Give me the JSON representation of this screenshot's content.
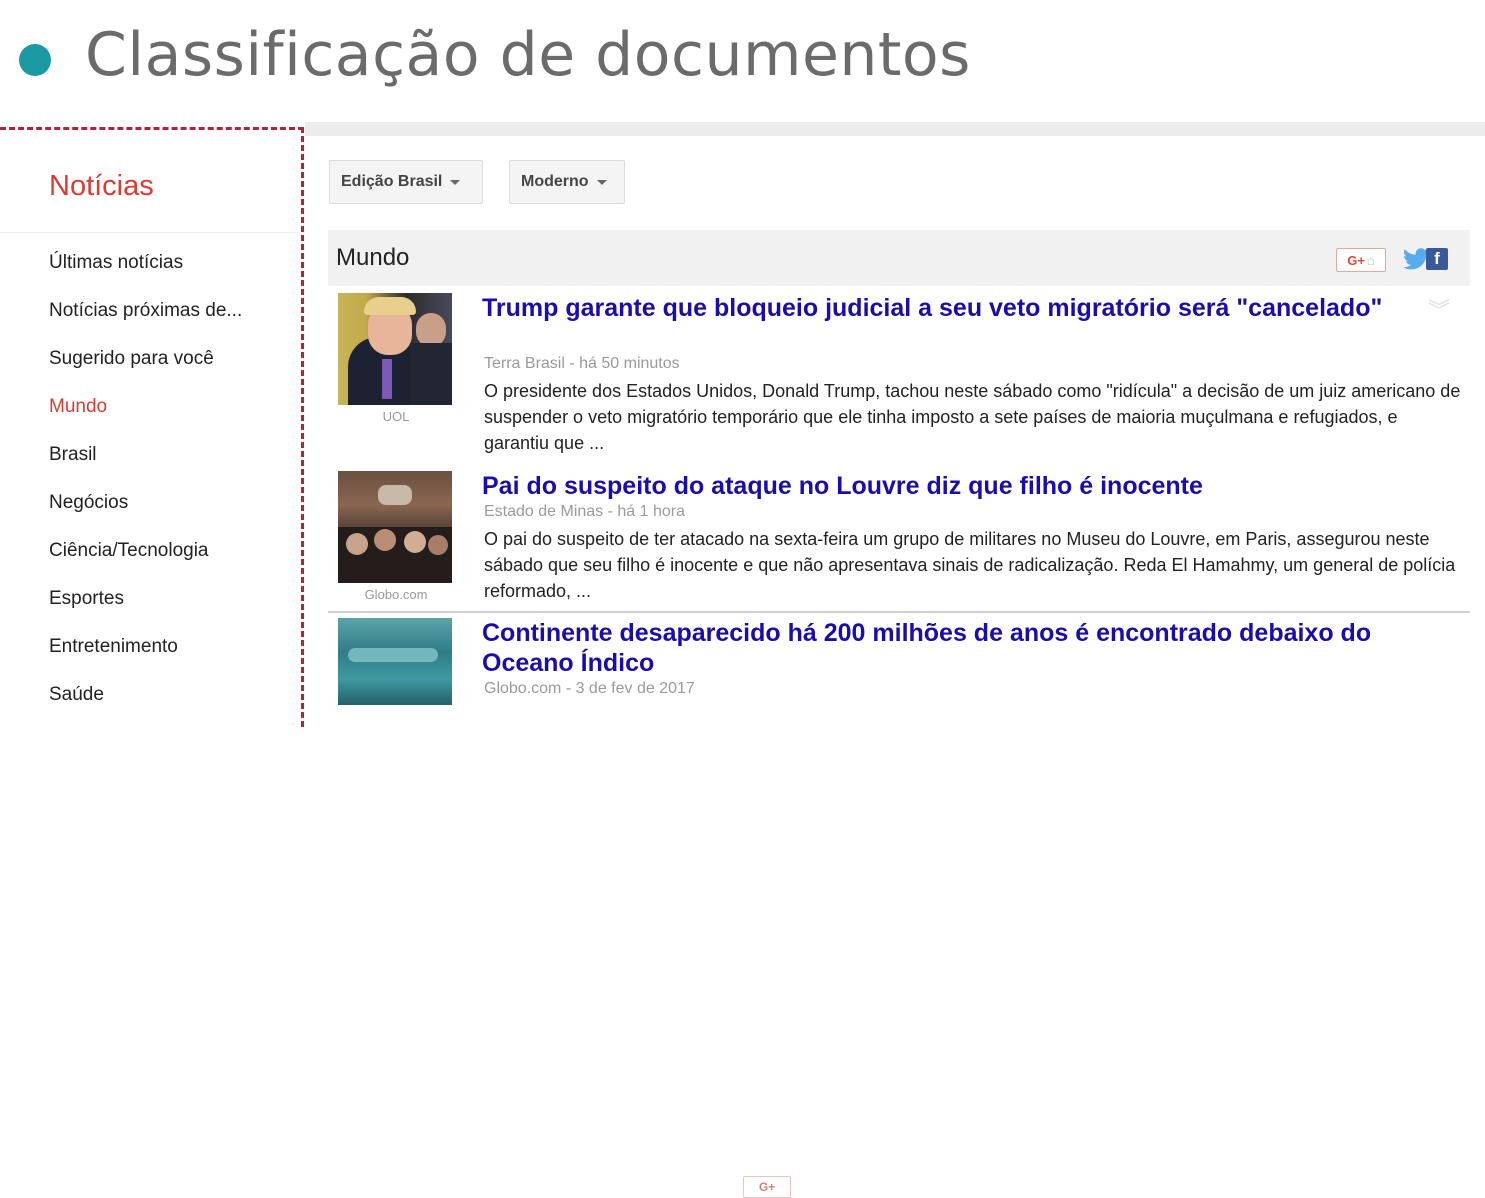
{
  "slide": {
    "title": "Classificação de documentos",
    "accent_color": "#1b9aa3"
  },
  "sidebar": {
    "brand": "Notícias",
    "items": [
      {
        "label": "Últimas notícias",
        "active": false
      },
      {
        "label": "Notícias próximas de...",
        "active": false
      },
      {
        "label": "Sugerido para você",
        "active": false
      },
      {
        "label": "Mundo",
        "active": true
      },
      {
        "label": "Brasil",
        "active": false
      },
      {
        "label": "Negócios",
        "active": false
      },
      {
        "label": "Ciência/Tecnologia",
        "active": false
      },
      {
        "label": "Esportes",
        "active": false
      },
      {
        "label": "Entretenimento",
        "active": false
      },
      {
        "label": "Saúde",
        "active": false
      }
    ]
  },
  "toolbar": {
    "edition_label": "Edição Brasil",
    "view_label": "Moderno"
  },
  "section": {
    "title": "Mundo",
    "share_icons": [
      "google-plus-icon",
      "twitter-icon",
      "facebook-icon"
    ],
    "gplus_text": "G+",
    "facebook_text": "f"
  },
  "articles": [
    {
      "headline": "Trump garante que bloqueio judicial a seu veto migratório será \"cancelado\"",
      "meta": "Terra Brasil - há 50 minutos",
      "snippet": "O presidente dos Estados Unidos, Donald Trump, tachou neste sábado como \"ridícula\" a decisão de um juiz americano de suspender o veto migratório temporário que ele tinha imposto a sete países de maioria muçulmana e refugiados, e garantiu que ...",
      "image_source": "UOL"
    },
    {
      "headline": "Pai do suspeito do ataque no Louvre diz que filho é inocente",
      "meta": "Estado de Minas - há 1 hora",
      "snippet": "O pai do suspeito de ter atacado na sexta-feira um grupo de militares no Museu do Louvre, em Paris, assegurou neste sábado que seu filho é inocente e que não apresentava sinais de radicalização. Reda El Hamahmy, um general de polícia reformado, ...",
      "image_source": "Globo.com"
    },
    {
      "headline": "Continente desaparecido há 200 milhões de anos é encontrado debaixo do Oceano Índico",
      "meta": "Globo.com - 3 de fev de 2017",
      "gplus_text": "G+"
    }
  ],
  "colors": {
    "brand_red": "#dd3a30",
    "headline_blue": "#1a0dab",
    "dashed_border": "#b0233b"
  }
}
